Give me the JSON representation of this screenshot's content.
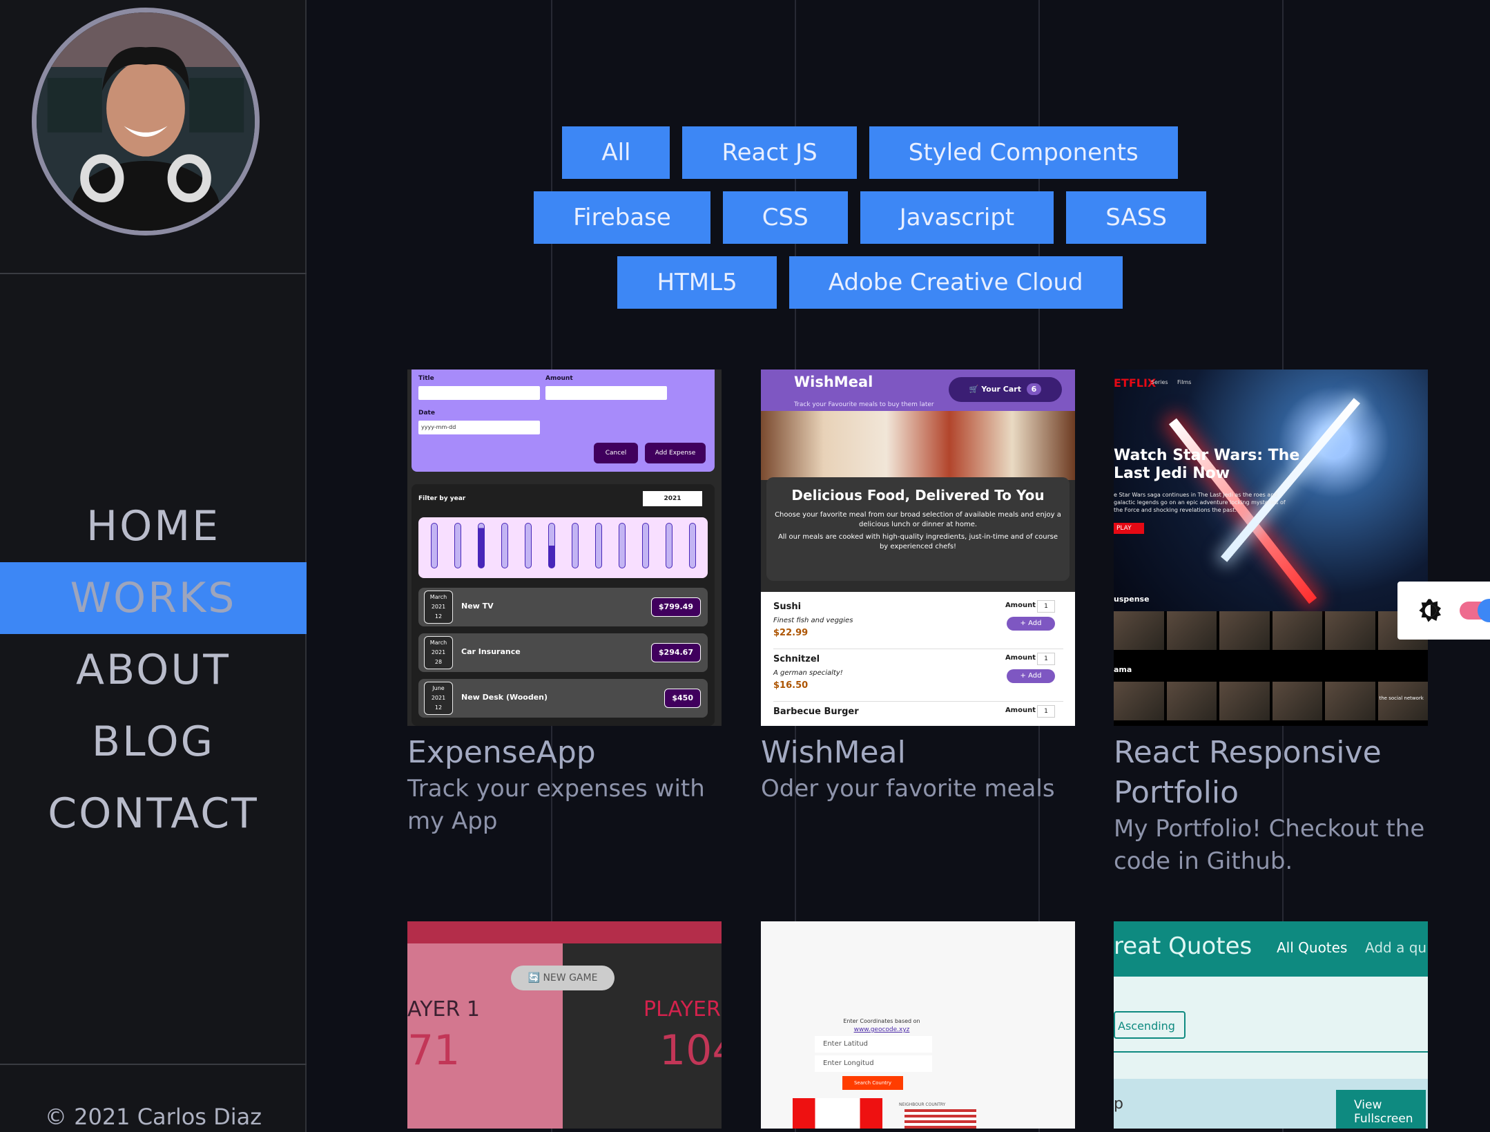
{
  "sidebar": {
    "nav": [
      "HOME",
      "WORKS",
      "ABOUT",
      "BLOG",
      "CONTACT"
    ],
    "active": "WORKS",
    "copyright": "© 2021 Carlos Diaz"
  },
  "main": {
    "tags_row1": [
      "All",
      "React JS",
      "Styled Components"
    ],
    "tags_row2": [
      "Firebase",
      "CSS",
      "Javascript",
      "SASS"
    ],
    "tags_row3": [
      "HTML5",
      "Adobe Creative Cloud"
    ],
    "projects": [
      {
        "title": "ExpenseApp",
        "desc": "Track your expenses with my App"
      },
      {
        "title": "WishMeal",
        "desc": "Oder your favorite meals"
      },
      {
        "title": "React Responsive Portfolio",
        "desc": "My Portfolio! Checkout the code in Github."
      }
    ]
  },
  "expense_mock": {
    "title_label": "Title",
    "amount_label": "Amount",
    "date_label": "Date",
    "date_placeholder": "yyyy-mm-dd",
    "cancel": "Cancel",
    "add": "Add Expense",
    "filter": "Filter by year",
    "year": "2021",
    "rows": [
      {
        "month": "March",
        "year": "2021",
        "day": "12",
        "name": "New TV",
        "price": "$799.49"
      },
      {
        "month": "March",
        "year": "2021",
        "day": "28",
        "name": "Car Insurance",
        "price": "$294.67"
      },
      {
        "month": "June",
        "year": "2021",
        "day": "12",
        "name": "New Desk (Wooden)",
        "price": "$450"
      }
    ]
  },
  "wishmeal_mock": {
    "logo": "WishMeal",
    "subtitle": "Track your Favourite meals to buy them later",
    "cart": "Your Cart",
    "cart_count": "6",
    "heading": "Delicious Food, Delivered To You",
    "p1": "Choose your favorite meal from our broad selection of available meals and enjoy a delicious lunch or dinner at home.",
    "p2": "All our meals are cooked with high-quality ingredients, just-in-time and of course by experienced chefs!",
    "amount_label": "Amount",
    "qty": "1",
    "add": "+ Add",
    "items": [
      {
        "name": "Sushi",
        "desc": "Finest fish and veggies",
        "price": "$22.99"
      },
      {
        "name": "Schnitzel",
        "desc": "A german specialty!",
        "price": "$16.50"
      },
      {
        "name": "Barbecue Burger",
        "desc": "",
        "price": ""
      }
    ]
  },
  "netflix_mock": {
    "logo": "ETFLIX",
    "series": "Series",
    "films": "Films",
    "title_line1": "Watch Star Wars: The",
    "title_line2": "Last Jedi Now",
    "blurb": "e Star Wars saga continues in The Last Jedi as the roes and galactic legends go on an epic adventure locking mysteries of the Force and shocking revelations the past.",
    "play": "PLAY",
    "row1": "uspense",
    "row2": "ama",
    "badge": "the social network"
  },
  "game_mock": {
    "new_game": "NEW GAME",
    "p1": "AYER 1",
    "p2": "PLAYER",
    "s1": "71",
    "s2": "104"
  },
  "geo_mock": {
    "heading": "Enter Coordinates based on",
    "link": "www.geocode.xyz",
    "lat": "Enter Latitud",
    "lng": "Enter Longitud",
    "btn": "Search Country",
    "neighbour": "NEIGHBOUR COUNTRY"
  },
  "quotes_mock": {
    "title": "reat Quotes",
    "all": "All Quotes",
    "add": "Add a qu",
    "sort": "Ascending",
    "view1": "View",
    "view2": "Fullscreen",
    "p": "p"
  },
  "colors": {
    "accent": "#3d87f5",
    "bg": "#0d0f17",
    "sidebar": "#141519"
  }
}
